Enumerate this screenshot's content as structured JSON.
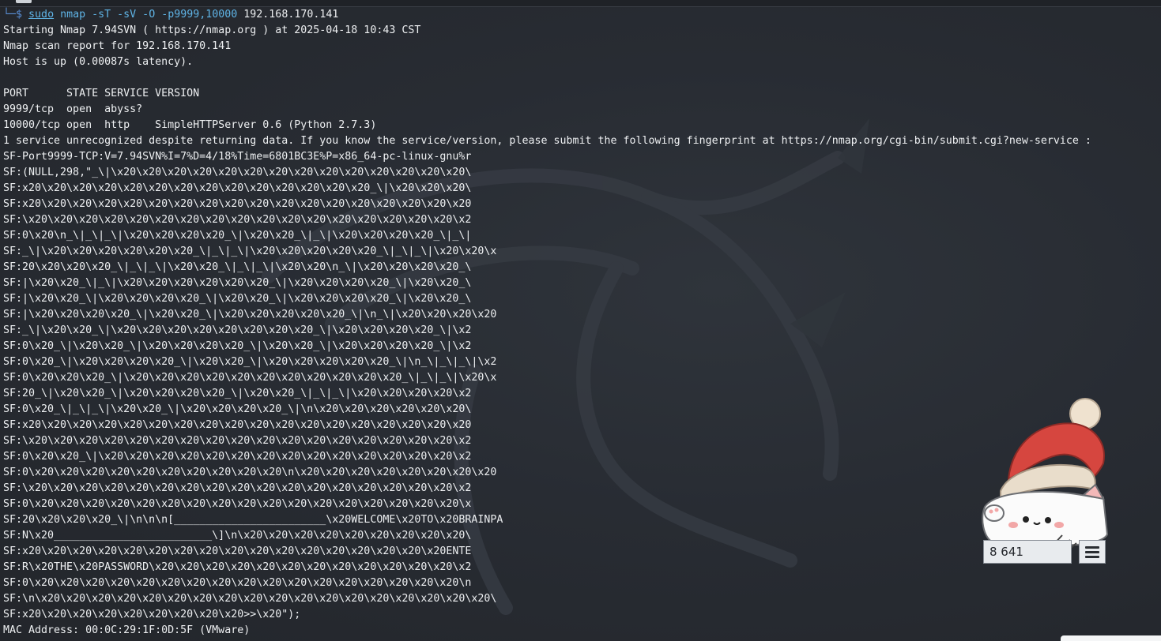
{
  "prompt": {
    "corner": "└─$",
    "sudo": "sudo",
    "nmap": "nmap",
    "args": "-sT -sV -O -p9999,10000",
    "target": "192.168.170.141"
  },
  "output_lines": [
    "Starting Nmap 7.94SVN ( https://nmap.org ) at 2025-04-18 10:43 CST",
    "Nmap scan report for 192.168.170.141",
    "Host is up (0.00087s latency).",
    "",
    "PORT      STATE SERVICE VERSION",
    "9999/tcp  open  abyss?",
    "10000/tcp open  http    SimpleHTTPServer 0.6 (Python 2.7.3)",
    "1 service unrecognized despite returning data. If you know the service/version, please submit the following fingerprint at https://nmap.org/cgi-bin/submit.cgi?new-service :",
    "SF-Port9999-TCP:V=7.94SVN%I=7%D=4/18%Time=6801BC3E%P=x86_64-pc-linux-gnu%r",
    "SF:(NULL,298,\"_\\|\\x20\\x20\\x20\\x20\\x20\\x20\\x20\\x20\\x20\\x20\\x20\\x20\\x20\\x20\\",
    "SF:x20\\x20\\x20\\x20\\x20\\x20\\x20\\x20\\x20\\x20\\x20\\x20\\x20\\x20_\\|\\x20\\x20\\x20\\",
    "SF:x20\\x20\\x20\\x20\\x20\\x20\\x20\\x20\\x20\\x20\\x20\\x20\\x20\\x20\\x20\\x20\\x20\\x20",
    "SF:\\x20\\x20\\x20\\x20\\x20\\x20\\x20\\x20\\x20\\x20\\x20\\x20\\x20\\x20\\x20\\x20\\x20\\x2",
    "SF:0\\x20\\n_\\|_\\|_\\|\\x20\\x20\\x20\\x20_\\|\\x20\\x20_\\|_\\|\\x20\\x20\\x20\\x20_\\|_\\|",
    "SF:_\\|\\x20\\x20\\x20\\x20\\x20\\x20_\\|_\\|_\\|\\x20\\x20\\x20\\x20\\x20_\\|_\\|_\\|\\x20\\x20\\x",
    "SF:20\\x20\\x20\\x20_\\|_\\|_\\|\\x20\\x20_\\|_\\|_\\|\\x20\\x20\\n_\\|\\x20\\x20\\x20\\x20_\\",
    "SF:|\\x20\\x20_\\|_\\|\\x20\\x20\\x20\\x20\\x20\\x20_\\|\\x20\\x20\\x20\\x20_\\|\\x20\\x20_\\",
    "SF:|\\x20\\x20_\\|\\x20\\x20\\x20\\x20_\\|\\x20\\x20_\\|\\x20\\x20\\x20\\x20_\\|\\x20\\x20_\\",
    "SF:|\\x20\\x20\\x20\\x20_\\|\\x20\\x20_\\|\\x20\\x20\\x20\\x20\\x20_\\|\\n_\\|\\x20\\x20\\x20\\x20",
    "SF:_\\|\\x20\\x20_\\|\\x20\\x20\\x20\\x20\\x20\\x20\\x20\\x20_\\|\\x20\\x20\\x20\\x20_\\|\\x2",
    "SF:0\\x20_\\|\\x20\\x20_\\|\\x20\\x20\\x20\\x20_\\|\\x20\\x20_\\|\\x20\\x20\\x20\\x20_\\|\\x2",
    "SF:0\\x20_\\|\\x20\\x20\\x20\\x20_\\|\\x20\\x20_\\|\\x20\\x20\\x20\\x20\\x20_\\|\\n_\\|_\\|_\\|\\x2",
    "SF:0\\x20\\x20\\x20_\\|\\x20\\x20\\x20\\x20\\x20\\x20\\x20\\x20\\x20\\x20\\x20_\\|_\\|_\\|\\x20\\x",
    "SF:20_\\|\\x20\\x20_\\|\\x20\\x20\\x20\\x20_\\|\\x20\\x20_\\|_\\|_\\|\\x20\\x20\\x20\\x20\\x2",
    "SF:0\\x20_\\|_\\|_\\|\\x20\\x20_\\|\\x20\\x20\\x20\\x20_\\|\\n\\x20\\x20\\x20\\x20\\x20\\x20\\",
    "SF:x20\\x20\\x20\\x20\\x20\\x20\\x20\\x20\\x20\\x20\\x20\\x20\\x20\\x20\\x20\\x20\\x20\\x20",
    "SF:\\x20\\x20\\x20\\x20\\x20\\x20\\x20\\x20\\x20\\x20\\x20\\x20\\x20\\x20\\x20\\x20\\x20\\x2",
    "SF:0\\x20\\x20_\\|\\x20\\x20\\x20\\x20\\x20\\x20\\x20\\x20\\x20\\x20\\x20\\x20\\x20\\x20\\x2",
    "SF:0\\x20\\x20\\x20\\x20\\x20\\x20\\x20\\x20\\x20\\x20\\n\\x20\\x20\\x20\\x20\\x20\\x20\\x20\\x20",
    "SF:\\x20\\x20\\x20\\x20\\x20\\x20\\x20\\x20\\x20\\x20\\x20\\x20\\x20\\x20\\x20\\x20\\x20\\x2",
    "SF:0\\x20\\x20\\x20\\x20\\x20\\x20\\x20\\x20\\x20\\x20\\x20\\x20\\x20\\x20\\x20\\x20\\x20\\x",
    "SF:20\\x20\\x20\\x20_\\|\\n\\n\\n[________________________\\x20WELCOME\\x20TO\\x20BRAINPA",
    "SF:N\\x20_________________________\\]\\n\\x20\\x20\\x20\\x20\\x20\\x20\\x20\\x20\\x20\\",
    "SF:x20\\x20\\x20\\x20\\x20\\x20\\x20\\x20\\x20\\x20\\x20\\x20\\x20\\x20\\x20\\x20\\x20ENTE",
    "SF:R\\x20THE\\x20PASSWORD\\x20\\x20\\x20\\x20\\x20\\x20\\x20\\x20\\x20\\x20\\x20\\x20\\x2",
    "SF:0\\x20\\x20\\x20\\x20\\x20\\x20\\x20\\x20\\x20\\x20\\x20\\x20\\x20\\x20\\x20\\x20\\x20\\n",
    "SF:\\n\\x20\\x20\\x20\\x20\\x20\\x20\\x20\\x20\\x20\\x20\\x20\\x20\\x20\\x20\\x20\\x20\\x20\\x20\\",
    "SF:x20\\x20\\x20\\x20\\x20\\x20\\x20\\x20\\x20>>\\x20\");",
    "MAC Address: 00:0C:29:1F:0D:5F (VMware)"
  ],
  "pet": {
    "counter": "8 641"
  }
}
